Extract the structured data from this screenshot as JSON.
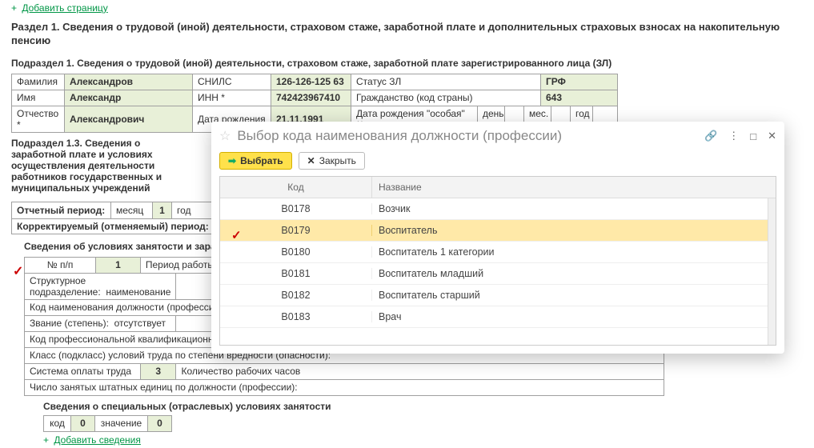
{
  "addPageLink": "Добавить страницу",
  "sectionTitle": "Раздел 1. Сведения о трудовой (иной) деятельности, страховом стаже, заработной плате и дополнительных страховых взносах на накопительную пенсию",
  "sub1Title": "Подраздел 1. Сведения о трудовой (иной) деятельности, страховом стаже, заработной плате зарегистрированного лица (ЗЛ)",
  "person": {
    "familyLabel": "Фамилия",
    "family": "Александров",
    "nameLabel": "Имя",
    "name": "Александр",
    "otchLabel": "Отчество *",
    "otch": "Александрович",
    "snilsLabel": "СНИЛС",
    "snils": "126-126-125 63",
    "innLabel": "ИНН *",
    "inn": "742423967410",
    "dobLabel": "Дата рождения",
    "dob": "21.11.1991",
    "statusLabel": "Статус ЗЛ",
    "citizLabel": "Гражданство (код страны)",
    "citiz": "643",
    "dobSpecialLabel": "Дата рождения \"особая\" **:",
    "dayLabel": "день",
    "monthLabel": "мес.",
    "yearLabel": "год",
    "grfLabel": "ГРФ"
  },
  "sub13Title": "Подраздел 1.3.  Сведения о заработной плате и условиях осуществления деятельности работников государственных и муниципальных учреждений",
  "period": {
    "label": "Отчетный период:",
    "monthLabel": "месяц",
    "month": "1",
    "yearLabel": "год",
    "corrLabel": "Корректируемый (отменяемый) период:"
  },
  "empTitle": "Сведения об условиях занятости и заработной плате",
  "emp": {
    "npLabel": "№ п/п",
    "np": "1",
    "periodLabel": "Период работы в отчетном месяце:",
    "structLabel": "Структурное подразделение:",
    "naim": "наименование",
    "codeLabel": "Код наименования должности (профессии):",
    "rankLabel": "Звание (степень):",
    "rankVal": "отсутствует",
    "profQualLabel": "Код профессиональной квалификационной группы:",
    "classLabel": "Класс (подкласс) условий труда по степени вредности (опасности):",
    "paySysLabel": "Система оплаты труда",
    "paySys": "3",
    "countLabel": "Количество рабочих часов",
    "posCountLabel": "Число занятых штатных единиц по должности (профессии):"
  },
  "specialTitle": "Сведения о специальных (отраслевых) условиях занятости",
  "special": {
    "codeLabel": "код",
    "code": "0",
    "valueLabel": "значение",
    "value": "0"
  },
  "addSved": "Добавить сведения",
  "modal": {
    "title": "Выбор кода наименования должности (профессии)",
    "selectBtn": "Выбрать",
    "closeBtn": "Закрыть",
    "colCode": "Код",
    "colName": "Название",
    "rows": [
      {
        "code": "B0178",
        "name": "Возчик"
      },
      {
        "code": "B0179",
        "name": "Воспитатель"
      },
      {
        "code": "B0180",
        "name": "Воспитатель 1 категории"
      },
      {
        "code": "B0181",
        "name": "Воспитатель младший"
      },
      {
        "code": "B0182",
        "name": "Воспитатель старший"
      },
      {
        "code": "B0183",
        "name": "Врач"
      }
    ],
    "selectedIndex": 1
  }
}
